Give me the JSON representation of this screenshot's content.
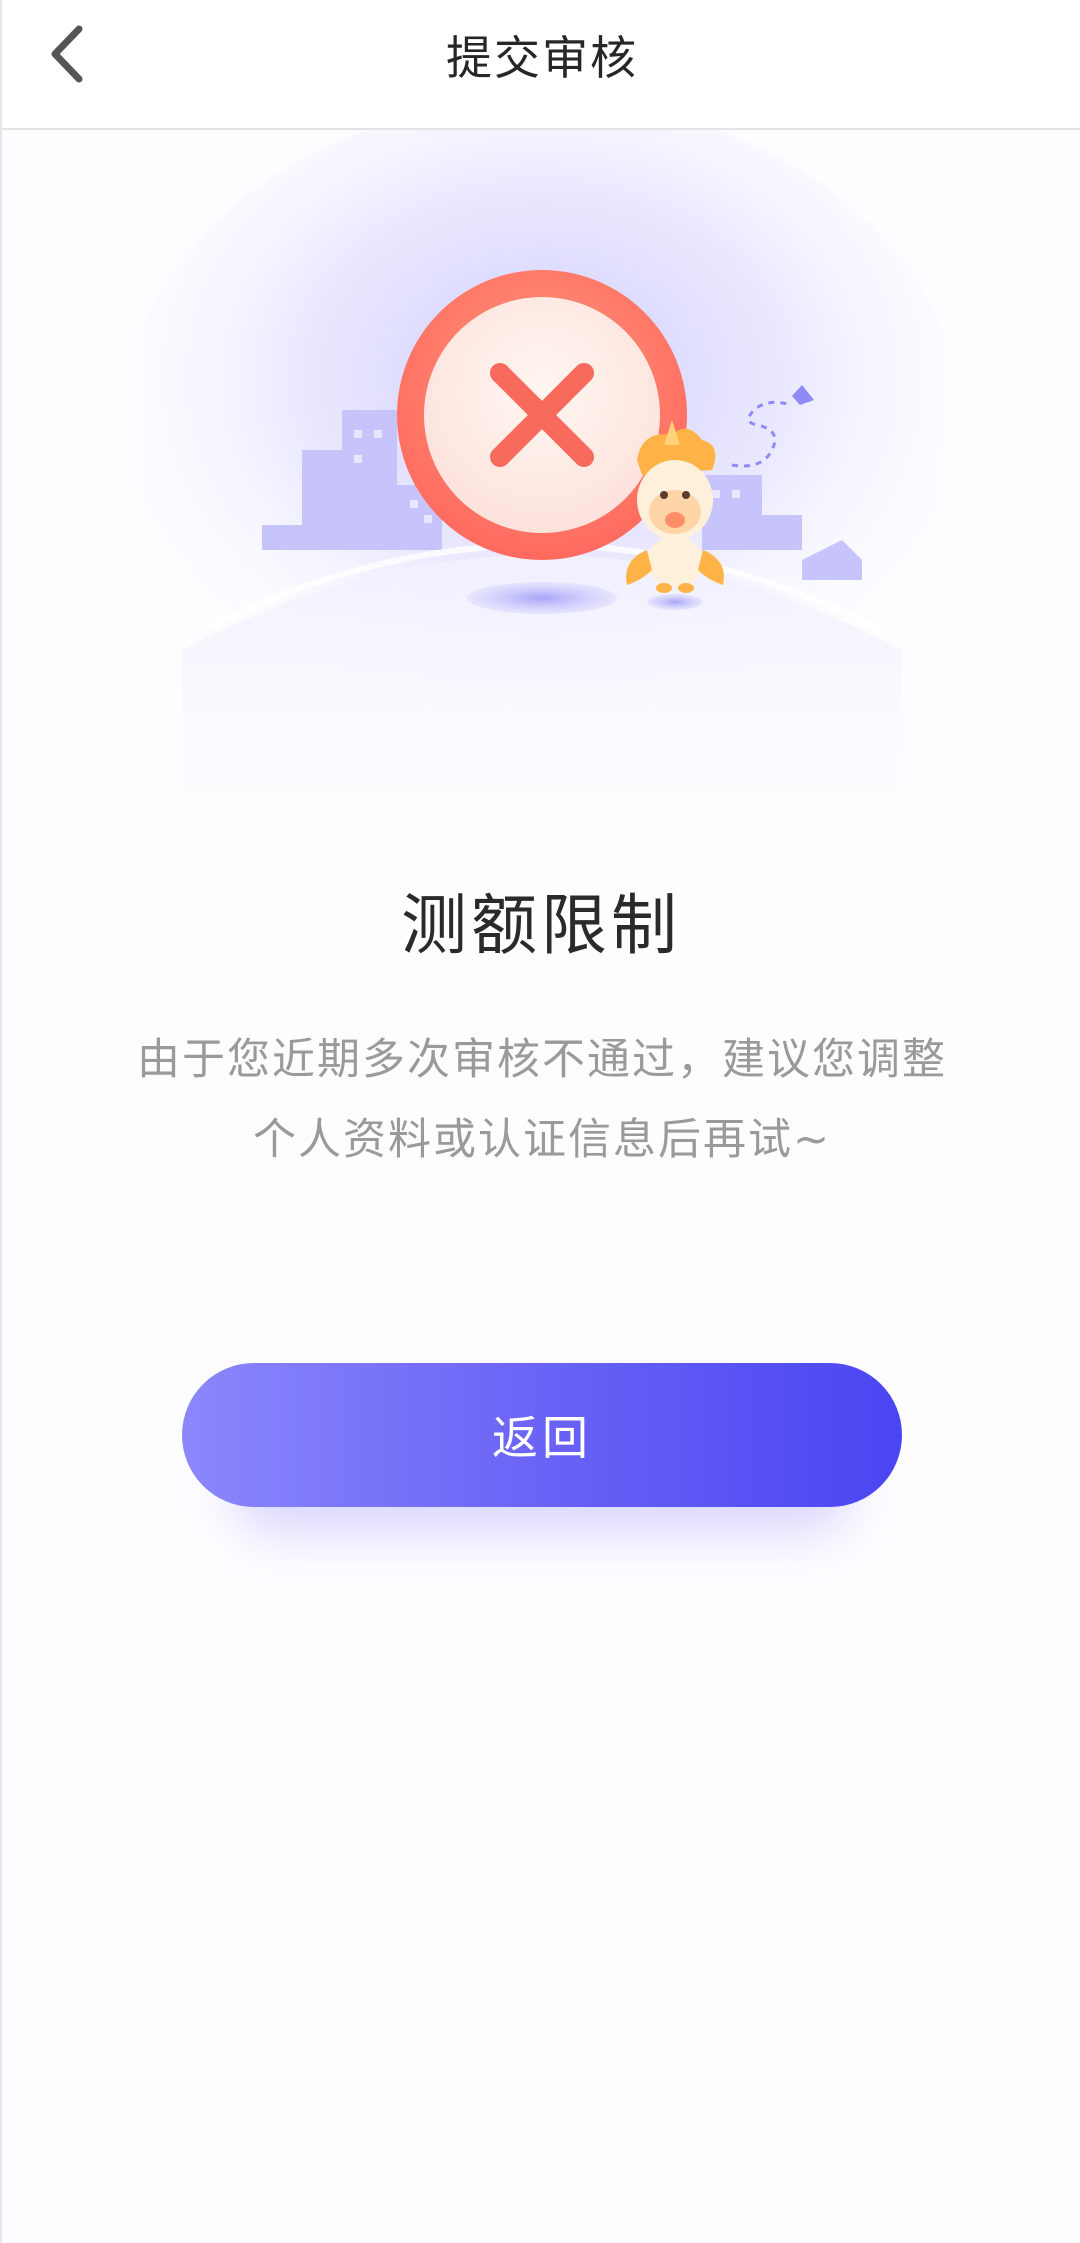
{
  "header": {
    "title": "提交审核",
    "back_icon": "chevron-left-icon"
  },
  "illustration": {
    "status_icon": "close-icon",
    "mascot": "unicorn-mascot",
    "colors": {
      "ring": "#ff7a63",
      "cross": "#f76a5c",
      "accent": "#6b64f6"
    }
  },
  "result": {
    "title": "测额限制",
    "description_lines": [
      "由于您近期多次审核不通过，建议您调整",
      "个人资料或认证信息后再试~"
    ]
  },
  "actions": {
    "return_label": "返回",
    "gradient_start": "#8b87fb",
    "gradient_end": "#4a45f2"
  }
}
